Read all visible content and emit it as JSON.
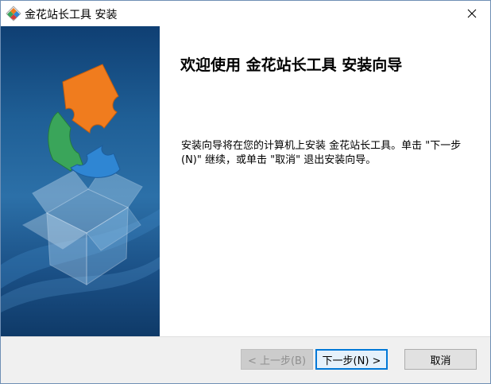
{
  "window": {
    "title": "金花站长工具 安装",
    "close_icon": "close-icon",
    "app_icon": "installer-app-icon"
  },
  "main": {
    "heading": "欢迎使用 金花站长工具 安装向导",
    "description": "安装向导将在您的计算机上安装 金花站长工具。单击 \"下一步(N)\" 继续，或单击 \"取消\" 退出安装向导。"
  },
  "buttons": {
    "back_label": "< 上一步(B)",
    "back_enabled": false,
    "next_label": "下一步(N) >",
    "cancel_label": "取消"
  },
  "colors": {
    "banner_dark": "#0f3f73",
    "banner_light": "#2c70a8",
    "puzzle_orange": "#f07c1e",
    "puzzle_green": "#3aa55a",
    "puzzle_blue": "#2f86d3",
    "default_button_border": "#0078d7",
    "button_bar": "#f0f0f0"
  }
}
